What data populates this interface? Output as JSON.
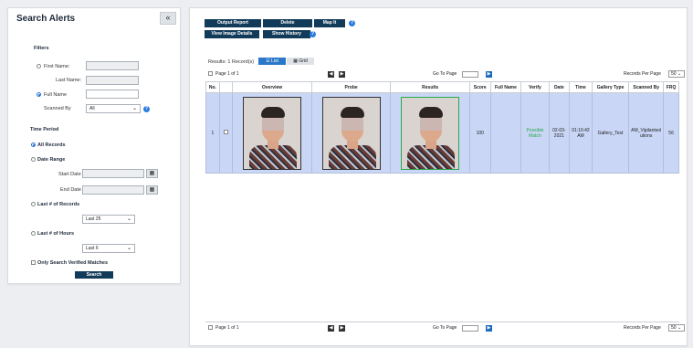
{
  "left": {
    "title": "Search Alerts",
    "collapse_glyph": "«",
    "filters_heading": "Filters",
    "first_name_label": "First Name:",
    "last_name_label": "Last Name:",
    "full_name_label": "Full Name",
    "scanned_by_label": "Scanned By",
    "scanned_by_value": "All",
    "time_period_heading": "Time Period",
    "all_records_label": "All Records",
    "date_range_label": "Date Range",
    "start_date_label": "Start Date",
    "end_date_label": "End Date",
    "last_records_label": "Last # of Records",
    "last_records_value": "Last 25",
    "last_hours_label": "Last # of Hours",
    "last_hours_value": "Last 6",
    "verified_only_label": "Only Search Verified Matches",
    "search_button": "Search"
  },
  "toolbar": {
    "output_report": "Output Report",
    "delete": "Delete",
    "map_it": "Map It",
    "view_image_details": "View Image Details",
    "show_history": "Show History"
  },
  "results": {
    "count_text": "Results: 1 Record(s)",
    "list_tab": "List",
    "grid_tab": "Grid",
    "page_text": "Page 1 of 1",
    "goto_label": "Go To Page",
    "rpp_label": "Records Per Page",
    "rpp_value": "50"
  },
  "table": {
    "headers": [
      "No.",
      "",
      "Overview",
      "Probe",
      "Results",
      "Score",
      "Full Name",
      "Verify",
      "Date",
      "Time",
      "Gallery Type",
      "Scanned By",
      "FRQ"
    ],
    "row": {
      "no": "1",
      "score": "100",
      "full_name": "",
      "verify": "Possible Match",
      "date": "02-03-2021",
      "time": "01:16:42 AM",
      "gallery_type": "Gallery_Test",
      "scanned_by": "AM_Vigilantsolutions",
      "frq": "56"
    }
  },
  "icons": {
    "info": "info-icon",
    "calendar": "calendar-icon",
    "prev": "prev-page-icon",
    "next": "next-page-icon",
    "go": "go-icon",
    "list": "list-icon",
    "grid": "grid-icon"
  },
  "colors": {
    "primary_button": "#123b5a",
    "selected_row": "#c9d6f6",
    "verify_text": "#2aa84a",
    "info_icon": "#2a7de1"
  }
}
